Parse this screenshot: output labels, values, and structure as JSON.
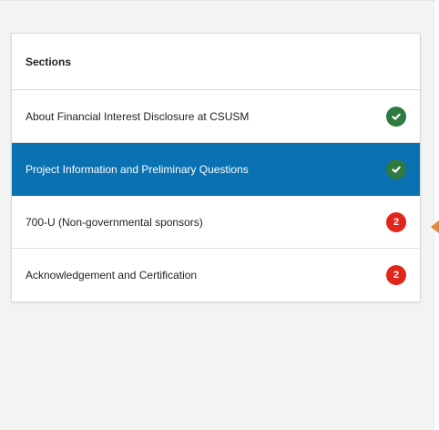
{
  "sections_panel": {
    "title": "Sections",
    "items": [
      {
        "label": "About Financial Interest Disclosure at CSUSM",
        "status": "complete",
        "status_text": "",
        "active": false
      },
      {
        "label": "Project Information and Preliminary Questions",
        "status": "complete",
        "status_text": "",
        "active": true
      },
      {
        "label": "700-U (Non-governmental sponsors)",
        "status": "alert",
        "status_text": "2",
        "active": false
      },
      {
        "label": "Acknowledgement and Certification",
        "status": "alert",
        "status_text": "2",
        "active": false
      }
    ]
  },
  "colors": {
    "active_bg": "#0a71b2",
    "complete": "#2f7a3f",
    "alert": "#e1261c",
    "pointer": "#e08a3c"
  }
}
